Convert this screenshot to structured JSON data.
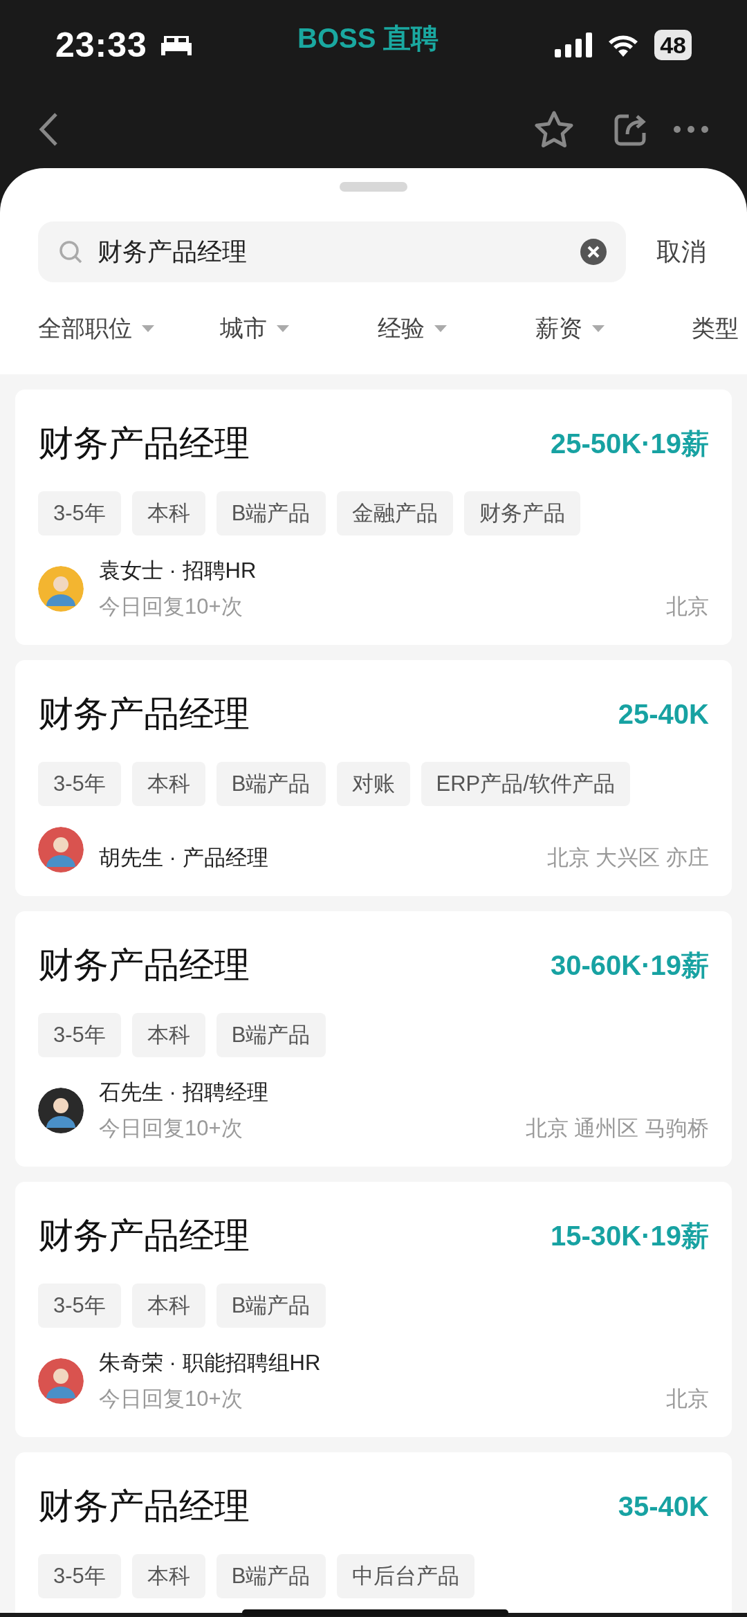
{
  "status_bar": {
    "time": "23:33",
    "app_logo": "BOSS 直聘",
    "battery": "48"
  },
  "search": {
    "value": "财务产品经理",
    "cancel": "取消"
  },
  "filters": [
    {
      "label": "全部职位",
      "dropdown": true
    },
    {
      "label": "城市",
      "dropdown": true
    },
    {
      "label": "经验",
      "dropdown": true
    },
    {
      "label": "薪资",
      "dropdown": true
    },
    {
      "label": "类型"
    }
  ],
  "jobs": [
    {
      "title": "财务产品经理",
      "salary": "25-50K·19薪",
      "tags": [
        "3-5年",
        "本科",
        "B端产品",
        "金融产品",
        "财务产品"
      ],
      "recruiter": "袁女士 · 招聘HR",
      "activity": "今日回复10+次",
      "location": "北京",
      "avatar": {
        "color": "#f3b530"
      }
    },
    {
      "title": "财务产品经理",
      "salary": "25-40K",
      "tags": [
        "3-5年",
        "本科",
        "B端产品",
        "对账",
        "ERP产品/软件产品"
      ],
      "recruiter": "胡先生 · 产品经理",
      "location": "北京 大兴区 亦庄",
      "avatar": {
        "color": "#d9534f"
      }
    },
    {
      "title": "财务产品经理",
      "salary": "30-60K·19薪",
      "tags": [
        "3-5年",
        "本科",
        "B端产品"
      ],
      "recruiter": "石先生 · 招聘经理",
      "activity": "今日回复10+次",
      "location": "北京 通州区 马驹桥",
      "avatar": {
        "color": "#2a2a2a"
      }
    },
    {
      "title": "财务产品经理",
      "salary": "15-30K·19薪",
      "tags": [
        "3-5年",
        "本科",
        "B端产品"
      ],
      "recruiter": "朱奇荣 · 职能招聘组HR",
      "activity": "今日回复10+次",
      "location": "北京",
      "avatar": {
        "color": "#d9534f"
      }
    },
    {
      "title": "财务产品经理",
      "salary": "35-40K",
      "tags": [
        "3-5年",
        "本科",
        "B端产品",
        "中后台产品"
      ]
    }
  ]
}
